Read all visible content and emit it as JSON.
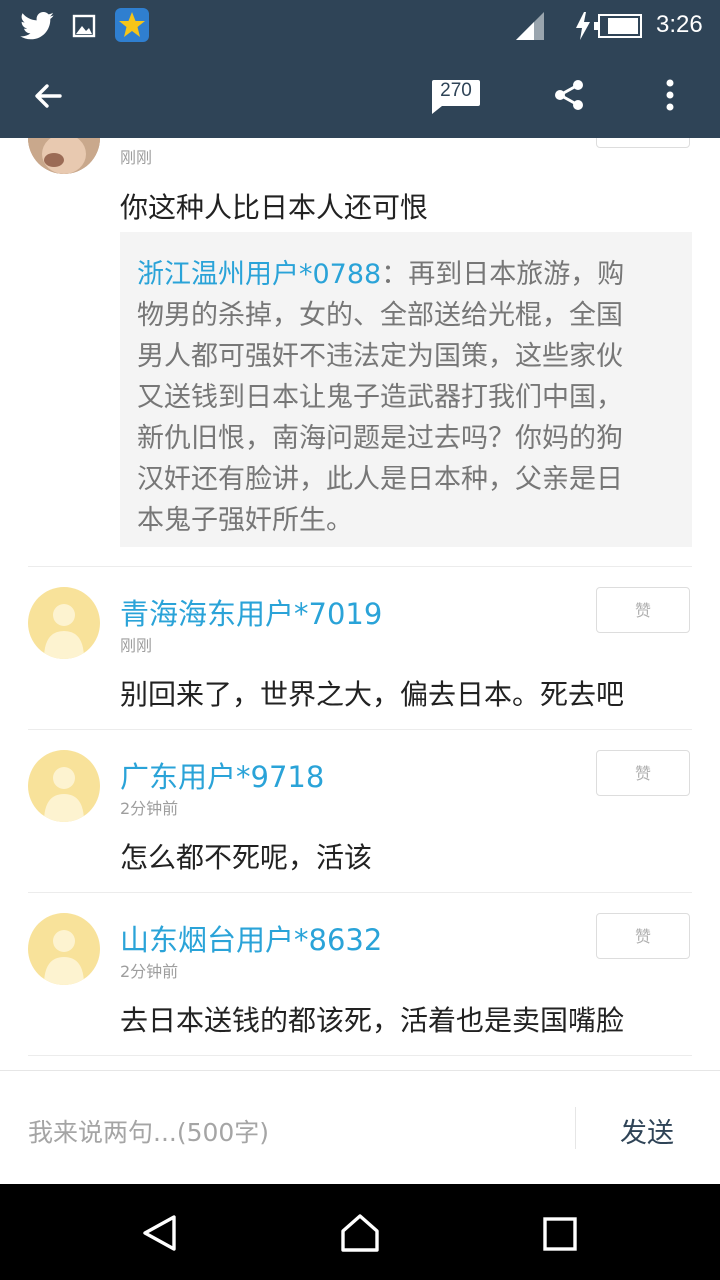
{
  "status_bar": {
    "time": "3:26",
    "icons": [
      "twitter-icon",
      "image-icon",
      "star-app-icon",
      "signal-icon",
      "charging-icon",
      "battery-icon"
    ]
  },
  "app_bar": {
    "comment_count": "270",
    "icons": [
      "back-arrow-icon",
      "comment-icon",
      "share-icon",
      "more-icon"
    ]
  },
  "comments": [
    {
      "time": "刚刚",
      "text": "你这种人比日本人还可恨",
      "quote": {
        "author": "浙江温州用户*0788",
        "lines": [
          "：再到日本旅游，购",
          "物男的杀掉，女的、全部送给光棍，全国",
          "男人都可强奸不违法定为国策，这些家伙",
          "又送钱到日本让鬼子造武器打我们中国，",
          "新仇旧恨，南海问题是过去吗？你妈的狗",
          "汉奸还有脸讲，此人是日本种，父亲是日",
          "本鬼子强奸所生。"
        ]
      }
    },
    {
      "user": "青海海东用户*7019",
      "time": "刚刚",
      "text": "别回来了，世界之大，偏去日本。死去吧",
      "like_label": "赞"
    },
    {
      "user": "广东用户*9718",
      "time": "2分钟前",
      "text": "怎么都不死呢，活该",
      "like_label": "赞"
    },
    {
      "user": "山东烟台用户*8632",
      "time": "2分钟前",
      "text": "去日本送钱的都该死，活着也是卖国嘴脸",
      "like_label": "赞"
    }
  ],
  "input_bar": {
    "placeholder": "我来说两句...(500字)",
    "send_label": "发送"
  },
  "nav_bar": {
    "icons": [
      "back-triangle-icon",
      "home-icon",
      "recents-icon"
    ]
  },
  "colors": {
    "bar": "#2f4457",
    "username": "#2aa3d8",
    "avatar": "#f8e29a"
  }
}
